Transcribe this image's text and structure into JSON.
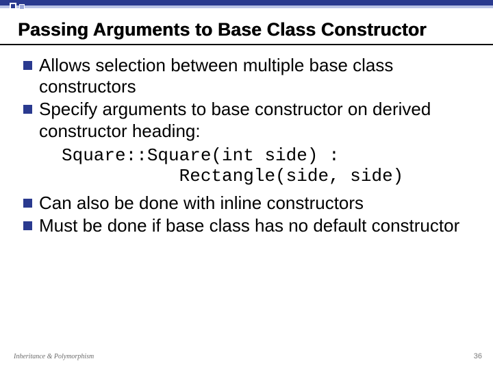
{
  "title": "Passing Arguments to Base Class Constructor",
  "bullets_a": [
    "Allows selection between multiple base class constructors",
    "Specify arguments to base constructor on derived constructor heading:"
  ],
  "code": "Square::Square(int side) :\n           Rectangle(side, side)",
  "bullets_b": [
    "Can also be done with inline constructors",
    "Must be done if base class has no default constructor"
  ],
  "footer": {
    "left": "Inheritance & Polymorphism",
    "right": "36"
  }
}
